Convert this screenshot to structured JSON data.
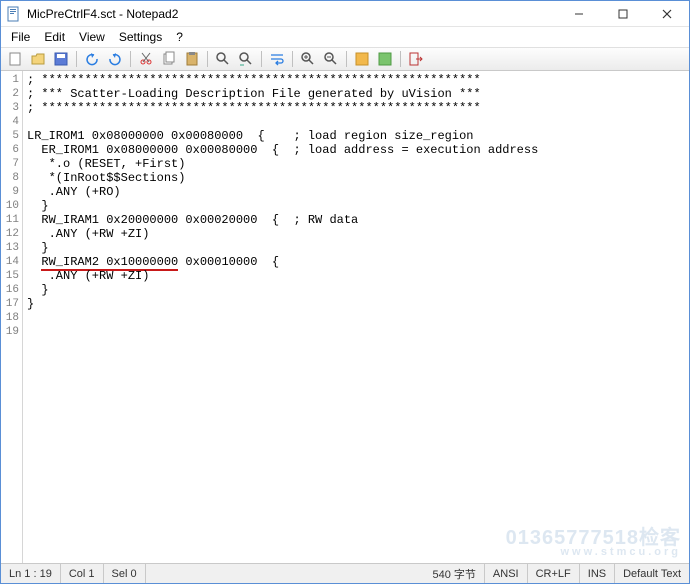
{
  "title": "MicPreCtrlF4.sct - Notepad2",
  "menu": {
    "file": "File",
    "edit": "Edit",
    "view": "View",
    "settings": "Settings",
    "help": "?"
  },
  "toolbar_icons": [
    "new",
    "open",
    "save",
    "sep",
    "undo",
    "redo",
    "sep",
    "cut",
    "copy",
    "paste",
    "sep",
    "find",
    "replace",
    "sep",
    "wordwrap",
    "sep",
    "zoomin",
    "zoomout",
    "sep",
    "scheme",
    "scheme2",
    "sep",
    "exit"
  ],
  "lines": [
    "; *************************************************************",
    "; *** Scatter-Loading Description File generated by uVision ***",
    "; *************************************************************",
    "",
    "LR_IROM1 0x08000000 0x00080000  {    ; load region size_region",
    "  ER_IROM1 0x08000000 0x00080000  {  ; load address = execution address",
    "   *.o (RESET, +First)",
    "   *(InRoot$$Sections)",
    "   .ANY (+RO)",
    "  }",
    "  RW_IRAM1 0x20000000 0x00020000  {  ; RW data",
    "   .ANY (+RW +ZI)",
    "  }",
    "  RW_IRAM2 0x10000000 0x00010000  {",
    "   .ANY (+RW +ZI)",
    "  }",
    "}",
    "",
    ""
  ],
  "underline_line_index": 13,
  "underline_text": "RW_IRAM2 0x10000000",
  "status": {
    "pos": "Ln 1 : 19",
    "col": "Col 1",
    "sel": "Sel 0",
    "bytes": "540 字节",
    "enc": "ANSI",
    "eol": "CR+LF",
    "ins": "INS",
    "lang": "Default Text"
  },
  "watermark": {
    "big": "01365777518检客",
    "small": "www.stmcu.org"
  }
}
